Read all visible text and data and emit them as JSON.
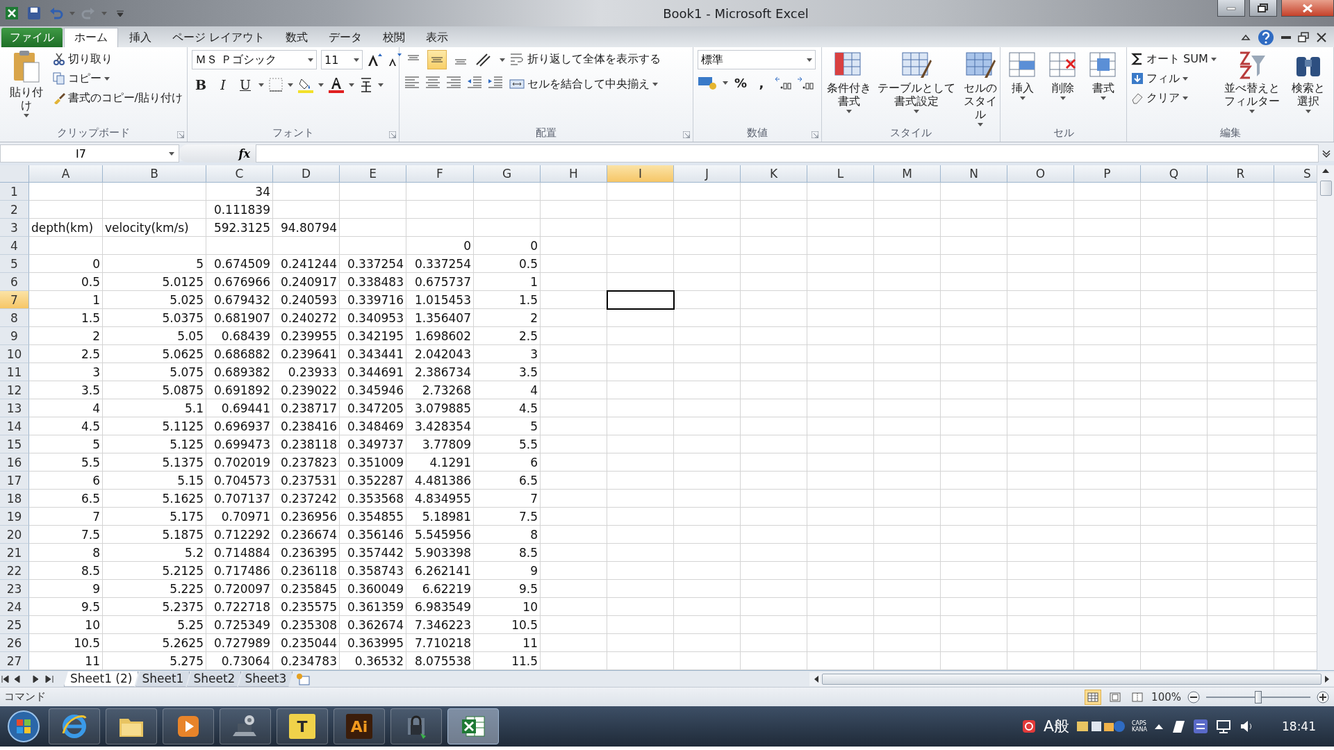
{
  "window": {
    "title": "Book1 - Microsoft Excel"
  },
  "tabs": [
    {
      "label": "ファイル",
      "kind": "file",
      "selected": false
    },
    {
      "label": "ホーム",
      "kind": "tab",
      "selected": true
    },
    {
      "label": "挿入",
      "kind": "tab",
      "selected": false
    },
    {
      "label": "ページ レイアウト",
      "kind": "tab",
      "selected": false
    },
    {
      "label": "数式",
      "kind": "tab",
      "selected": false
    },
    {
      "label": "データ",
      "kind": "tab",
      "selected": false
    },
    {
      "label": "校閲",
      "kind": "tab",
      "selected": false
    },
    {
      "label": "表示",
      "kind": "tab",
      "selected": false
    }
  ],
  "ribbon": [
    {
      "kind": "clipboard",
      "label": "クリップボード",
      "large": "貼り付け",
      "items": [
        "切り取り",
        "コピー",
        "書式のコピー/貼り付け"
      ]
    },
    {
      "kind": "font",
      "label": "フォント",
      "font_name": "ＭＳ Ｐゴシック",
      "font_size": "11",
      "styles": [
        "B",
        "I",
        "U"
      ]
    },
    {
      "kind": "alignment",
      "label": "配置",
      "vertical": [
        {
          "selected": false
        },
        {
          "selected": true
        },
        {
          "selected": false
        }
      ],
      "wrap": "折り返して全体を表示する",
      "merge": "セルを結合して中央揃え"
    },
    {
      "kind": "number",
      "label": "数値",
      "format": "標準",
      "symbols": [
        "%",
        ","
      ]
    },
    {
      "kind": "styles",
      "label": "スタイル",
      "buttons": [
        "条件付き書式",
        "テーブルとして書式設定",
        "セルのスタイル"
      ]
    },
    {
      "kind": "cells",
      "label": "セル",
      "buttons": [
        "挿入",
        "削除",
        "書式"
      ]
    },
    {
      "kind": "editing",
      "label": "編集",
      "items": [
        "オート SUM",
        "フィル",
        "クリア"
      ],
      "buttons": [
        "並べ替えとフィルター",
        "検索と選択"
      ]
    }
  ],
  "formula_bar": {
    "name_box": "I7",
    "function_button": "fx"
  },
  "columns": [
    {
      "label": "A",
      "selected": false
    },
    {
      "label": "B",
      "selected": false
    },
    {
      "label": "C",
      "selected": false
    },
    {
      "label": "D",
      "selected": false
    },
    {
      "label": "E",
      "selected": false
    },
    {
      "label": "F",
      "selected": false
    },
    {
      "label": "G",
      "selected": false
    },
    {
      "label": "H",
      "selected": false
    },
    {
      "label": "I",
      "selected": true
    },
    {
      "label": "J",
      "selected": false
    },
    {
      "label": "K",
      "selected": false
    },
    {
      "label": "L",
      "selected": false
    },
    {
      "label": "M",
      "selected": false
    },
    {
      "label": "N",
      "selected": false
    },
    {
      "label": "O",
      "selected": false
    },
    {
      "label": "P",
      "selected": false
    },
    {
      "label": "Q",
      "selected": false
    },
    {
      "label": "R",
      "selected": false
    },
    {
      "label": "S",
      "selected": false
    }
  ],
  "rows": [
    {
      "number": "1",
      "selected": false,
      "cells": [
        null,
        null,
        "34",
        null,
        null,
        null,
        null
      ]
    },
    {
      "number": "2",
      "selected": false,
      "cells": [
        null,
        null,
        "0.111839",
        null,
        null,
        null,
        null
      ]
    },
    {
      "number": "3",
      "selected": false,
      "cells": [
        {
          "kind": "text",
          "text": "depth(km)"
        },
        {
          "kind": "text",
          "text": "velocity(km/s)"
        },
        "592.3125",
        "94.80794",
        null,
        null,
        null
      ]
    },
    {
      "number": "4",
      "selected": false,
      "cells": [
        null,
        null,
        null,
        null,
        null,
        "0",
        "0"
      ]
    },
    {
      "number": "5",
      "selected": false,
      "cells": [
        "0",
        "5",
        "0.674509",
        "0.241244",
        "0.337254",
        "0.337254",
        "0.5"
      ]
    },
    {
      "number": "6",
      "selected": false,
      "cells": [
        "0.5",
        "5.0125",
        "0.676966",
        "0.240917",
        "0.338483",
        "0.675737",
        "1"
      ]
    },
    {
      "number": "7",
      "selected": true,
      "cells": [
        "1",
        "5.025",
        "0.679432",
        "0.240593",
        "0.339716",
        "1.015453",
        "1.5"
      ]
    },
    {
      "number": "8",
      "selected": false,
      "cells": [
        "1.5",
        "5.0375",
        "0.681907",
        "0.240272",
        "0.340953",
        "1.356407",
        "2"
      ]
    },
    {
      "number": "9",
      "selected": false,
      "cells": [
        "2",
        "5.05",
        "0.68439",
        "0.239955",
        "0.342195",
        "1.698602",
        "2.5"
      ]
    },
    {
      "number": "10",
      "selected": false,
      "cells": [
        "2.5",
        "5.0625",
        "0.686882",
        "0.239641",
        "0.343441",
        "2.042043",
        "3"
      ]
    },
    {
      "number": "11",
      "selected": false,
      "cells": [
        "3",
        "5.075",
        "0.689382",
        "0.23933",
        "0.344691",
        "2.386734",
        "3.5"
      ]
    },
    {
      "number": "12",
      "selected": false,
      "cells": [
        "3.5",
        "5.0875",
        "0.691892",
        "0.239022",
        "0.345946",
        "2.73268",
        "4"
      ]
    },
    {
      "number": "13",
      "selected": false,
      "cells": [
        "4",
        "5.1",
        "0.69441",
        "0.238717",
        "0.347205",
        "3.079885",
        "4.5"
      ]
    },
    {
      "number": "14",
      "selected": false,
      "cells": [
        "4.5",
        "5.1125",
        "0.696937",
        "0.238416",
        "0.348469",
        "3.428354",
        "5"
      ]
    },
    {
      "number": "15",
      "selected": false,
      "cells": [
        "5",
        "5.125",
        "0.699473",
        "0.238118",
        "0.349737",
        "3.77809",
        "5.5"
      ]
    },
    {
      "number": "16",
      "selected": false,
      "cells": [
        "5.5",
        "5.1375",
        "0.702019",
        "0.237823",
        "0.351009",
        "4.1291",
        "6"
      ]
    },
    {
      "number": "17",
      "selected": false,
      "cells": [
        "6",
        "5.15",
        "0.704573",
        "0.237531",
        "0.352287",
        "4.481386",
        "6.5"
      ]
    },
    {
      "number": "18",
      "selected": false,
      "cells": [
        "6.5",
        "5.1625",
        "0.707137",
        "0.237242",
        "0.353568",
        "4.834955",
        "7"
      ]
    },
    {
      "number": "19",
      "selected": false,
      "cells": [
        "7",
        "5.175",
        "0.70971",
        "0.236956",
        "0.354855",
        "5.18981",
        "7.5"
      ]
    },
    {
      "number": "20",
      "selected": false,
      "cells": [
        "7.5",
        "5.1875",
        "0.712292",
        "0.236674",
        "0.356146",
        "5.545956",
        "8"
      ]
    },
    {
      "number": "21",
      "selected": false,
      "cells": [
        "8",
        "5.2",
        "0.714884",
        "0.236395",
        "0.357442",
        "5.903398",
        "8.5"
      ]
    },
    {
      "number": "22",
      "selected": false,
      "cells": [
        "8.5",
        "5.2125",
        "0.717486",
        "0.236118",
        "0.358743",
        "6.262141",
        "9"
      ]
    },
    {
      "number": "23",
      "selected": false,
      "cells": [
        "9",
        "5.225",
        "0.720097",
        "0.235845",
        "0.360049",
        "6.62219",
        "9.5"
      ]
    },
    {
      "number": "24",
      "selected": false,
      "cells": [
        "9.5",
        "5.2375",
        "0.722718",
        "0.235575",
        "0.361359",
        "6.983549",
        "10"
      ]
    },
    {
      "number": "25",
      "selected": false,
      "cells": [
        "10",
        "5.25",
        "0.725349",
        "0.235308",
        "0.362674",
        "7.346223",
        "10.5"
      ]
    },
    {
      "number": "26",
      "selected": false,
      "cells": [
        "10.5",
        "5.2625",
        "0.727989",
        "0.235044",
        "0.363995",
        "7.710218",
        "11"
      ]
    },
    {
      "number": "27",
      "selected": false,
      "cells": [
        "11",
        "5.275",
        "0.73064",
        "0.234783",
        "0.36532",
        "8.075538",
        "11.5"
      ]
    }
  ],
  "sheet_tabs": [
    {
      "label": "Sheet1 (2)",
      "selected": true
    },
    {
      "label": "Sheet1",
      "selected": false
    },
    {
      "label": "Sheet2",
      "selected": false
    },
    {
      "label": "Sheet3",
      "selected": false
    }
  ],
  "status_bar": {
    "mode": "コマンド",
    "views": [
      {
        "selected": true
      },
      {
        "selected": false
      },
      {
        "selected": false
      }
    ],
    "zoom": "100%",
    "zoom_slider": {
      "level": 0.5
    }
  },
  "taskbar": {
    "apps": [
      {
        "kind": "ie",
        "selected": false
      },
      {
        "kind": "folder",
        "selected": false
      },
      {
        "kind": "media",
        "selected": false
      },
      {
        "kind": "settings",
        "selected": false
      },
      {
        "kind": "letter",
        "label": "T",
        "selected": false
      },
      {
        "kind": "illustrator",
        "label": "Ai",
        "selected": false
      },
      {
        "kind": "lock",
        "selected": false
      },
      {
        "kind": "excel",
        "selected": true
      }
    ],
    "ime": "A般",
    "caps": "CAPS",
    "kana": "KANA",
    "clock": "18:41"
  }
}
